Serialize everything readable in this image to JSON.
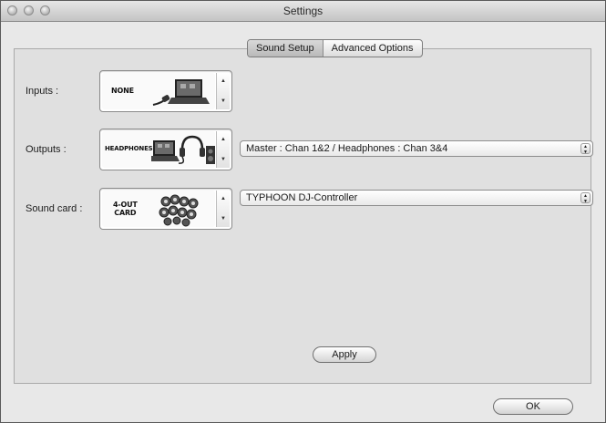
{
  "window": {
    "title": "Settings"
  },
  "tabs": [
    {
      "label": "Sound Setup",
      "active": true
    },
    {
      "label": "Advanced Options",
      "active": false
    }
  ],
  "rows": {
    "inputs": {
      "label": "Inputs :",
      "picker_text": "NONE",
      "picker_icon": "laptop-cable-icon"
    },
    "outputs": {
      "label": "Outputs :",
      "picker_text": "HEADPHONES",
      "picker_icon": "laptop-headphones-speaker-icon",
      "select_value": "Master : Chan 1&2 / Headphones : Chan 3&4"
    },
    "sound_card": {
      "label": "Sound card :",
      "picker_text_line1": "4-OUT",
      "picker_text_line2": "CARD",
      "picker_icon": "rca-connectors-icon",
      "select_value": "TYPHOON DJ-Controller"
    }
  },
  "buttons": {
    "apply": "Apply",
    "ok": "OK"
  },
  "colors": {
    "window_bg": "#e8e8e8",
    "panel_bg": "#e0e0e0"
  }
}
